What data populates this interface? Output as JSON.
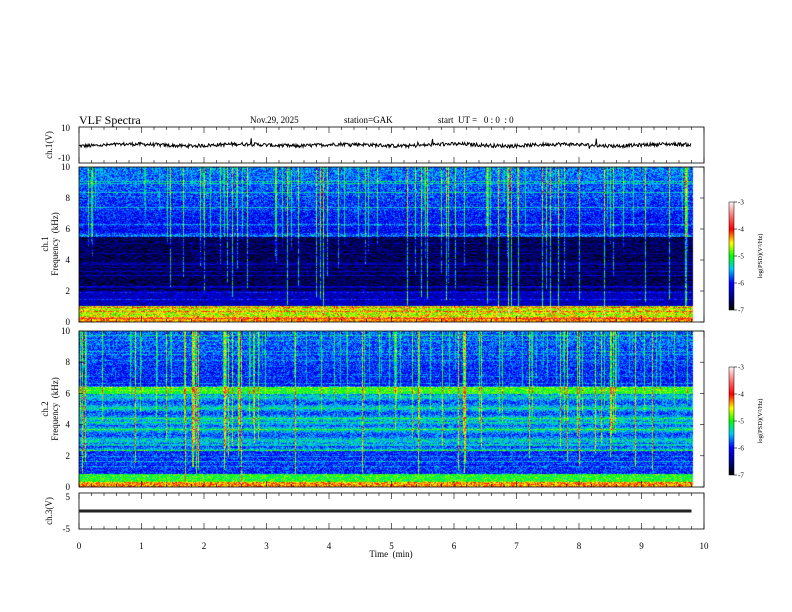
{
  "header": {
    "title": "VLF  Spectra",
    "date": "Nov.29, 2025",
    "station": "station=GAK",
    "start_ut": "start  UT =   0 : 0  : 0"
  },
  "chart_data": [
    {
      "type": "line",
      "panel": "ch1",
      "ylabel": "ch.1(V)",
      "ylim": [
        -10,
        10
      ],
      "yticks": [
        "10",
        "-10"
      ],
      "series_description_values": {
        "mean": 0,
        "noise_amplitude": 1
      }
    },
    {
      "type": "heatmap",
      "panel": "ch1-spectrogram",
      "ylabel": "ch.1\nFrequency (kHz)",
      "ylabel_lines": [
        "ch.1",
        "Frequency  (kHz)"
      ],
      "ylim": [
        0,
        10
      ],
      "yticks": [
        "0",
        "2",
        "4",
        "6",
        "8",
        "10"
      ],
      "colorbar": {
        "label": "log(PSD)(V²/Hz)",
        "range": [
          -7,
          -3
        ],
        "ticks": [
          "-3",
          "-4",
          "-5",
          "-6",
          "-7"
        ],
        "colormap": "jet"
      }
    },
    {
      "type": "heatmap",
      "panel": "ch2-spectrogram",
      "ylabel_lines": [
        "ch.2",
        "Frequency  (kHz)"
      ],
      "ylim": [
        0,
        10
      ],
      "yticks": [
        "0",
        "2",
        "4",
        "6",
        "8",
        "10"
      ],
      "colorbar": {
        "label": "log(PSD)(V²/Hz)",
        "range": [
          -7,
          -3
        ],
        "ticks": [
          "-3",
          "-4",
          "-5",
          "-6",
          "-7"
        ],
        "colormap": "jet"
      }
    },
    {
      "type": "line",
      "panel": "ch3",
      "ylabel": "ch.3(V)",
      "ylim": [
        -5,
        5
      ],
      "yticks": [
        "5",
        "-5"
      ],
      "constant_value": 0
    }
  ],
  "xaxis": {
    "label": "Time  (min)",
    "xlim": [
      0,
      10
    ],
    "data_end": 9.8,
    "ticks": [
      "0",
      "1",
      "2",
      "3",
      "4",
      "5",
      "6",
      "7",
      "8",
      "9",
      "10"
    ]
  }
}
